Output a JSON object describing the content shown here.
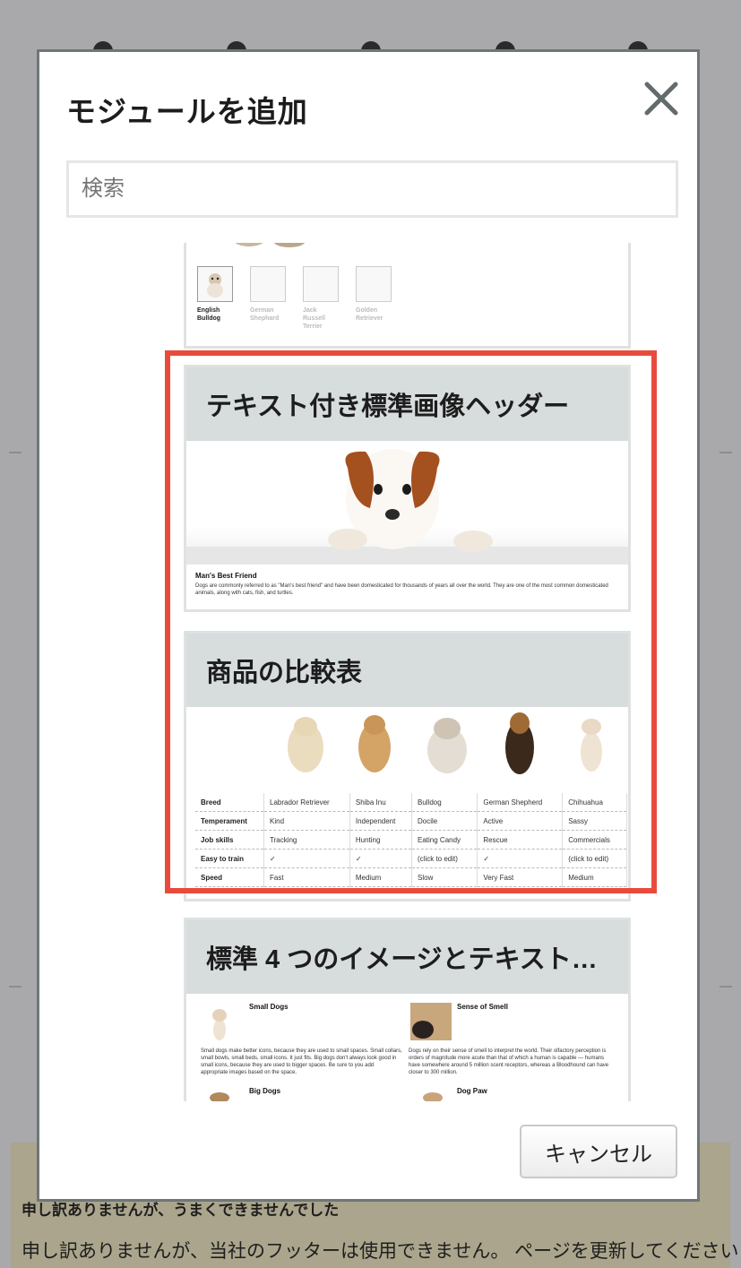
{
  "modal": {
    "title": "モジュールを追加",
    "search_placeholder": "検索",
    "cancel_label": "キャンセル"
  },
  "modules": [
    {
      "thumbnails": [
        {
          "label": "English Bulldog",
          "selected": true
        },
        {
          "label": "German Shephard",
          "selected": false
        },
        {
          "label": "Jack Russell Terrier",
          "selected": false
        },
        {
          "label": "Golden Retriever",
          "selected": false
        }
      ]
    },
    {
      "title": "テキスト付き標準画像ヘッダー",
      "preview_heading": "Man's Best Friend",
      "preview_body": "Dogs are commonly referred to as \"Man's best friend\" and have been domesticated for thousands of years all over the world. They are one of the most common domesticated animals, along with cats, fish, and turtles."
    },
    {
      "title": "商品の比較表",
      "table": {
        "rows": [
          [
            "Breed",
            "Labrador Retriever",
            "Shiba Inu",
            "Bulldog",
            "German Shepherd",
            "Chihuahua"
          ],
          [
            "Temperament",
            "Kind",
            "Independent",
            "Docile",
            "Active",
            "Sassy"
          ],
          [
            "Job skills",
            "Tracking",
            "Hunting",
            "Eating Candy",
            "Rescue",
            "Commercials"
          ],
          [
            "Easy to train",
            "✓",
            "✓",
            "(click to edit)",
            "✓",
            "(click to edit)"
          ],
          [
            "Speed",
            "Fast",
            "Medium",
            "Slow",
            "Very Fast",
            "Medium"
          ]
        ]
      }
    },
    {
      "title": "標準 4 つのイメージとテキスト…",
      "items": [
        {
          "title": "Small Dogs",
          "body": "Small dogs make better icons, because they are used to small spaces. Small collars, small bowls, small beds, small icons. It just fits. Big dogs don't always look good in small icons, because they are used to bigger spaces. Be sure to you add appropriate images based on the space."
        },
        {
          "title": "Sense of Smell",
          "body": "Dogs rely on their sense of smell to interpret the world. Their olfactory perception is orders of magnitude more acute than that of which a human is capable — humans have somewhere around 5 million scent receptors, whereas a Bloodhound can have closer to 300 million."
        },
        {
          "title": "Big Dogs",
          "body": ""
        },
        {
          "title": "Dog Paw",
          "body": ""
        }
      ]
    }
  ],
  "background": {
    "error_title": "申し訳ありませんが、うまくできませんでした",
    "error_message": "申し訳ありませんが、当社のフッターは使用できません。 ページを更新してください"
  },
  "colors": {
    "highlight": "#e84b3c",
    "card_header_bg": "#d7dcdd",
    "overlay": "#a9a9ab"
  }
}
